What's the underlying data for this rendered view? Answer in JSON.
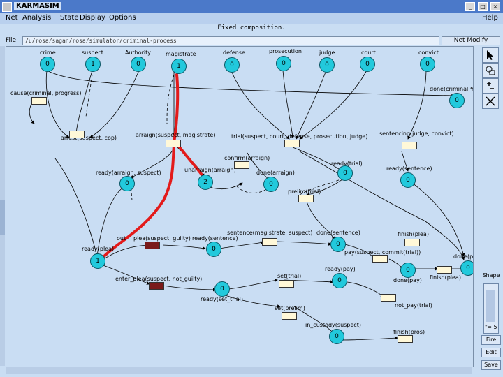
{
  "window": {
    "title": "KARMASIM",
    "buttons": [
      "_",
      "□",
      "×"
    ]
  },
  "menu": {
    "items": [
      "Net",
      "Analysis",
      "State",
      "Display",
      "Options"
    ],
    "help": "Help"
  },
  "net_name": "Fixed composition.",
  "file": {
    "label": "File",
    "path": "/u/rosa/sagan/rosa/simulator/criminal-process",
    "modify_label": "Net Modify"
  },
  "places": [
    {
      "name": "crime",
      "token": "0"
    },
    {
      "name": "suspect",
      "token": "1"
    },
    {
      "name": "Authority",
      "token": "0"
    },
    {
      "name": "magistrate",
      "token": "1"
    },
    {
      "name": "defense",
      "token": "0"
    },
    {
      "name": "prosecution",
      "token": "0"
    },
    {
      "name": "judge",
      "token": "0"
    },
    {
      "name": "court",
      "token": "0"
    },
    {
      "name": "convict",
      "token": "0"
    },
    {
      "name": "done(criminalProcess)",
      "token": "0"
    },
    {
      "name": "ready(arraign, suspect)",
      "token": "0"
    },
    {
      "name": "unarraign(arraign)",
      "token": "2"
    },
    {
      "name": "done(arraign)",
      "token": "0"
    },
    {
      "name": "ready(trial)",
      "token": "0"
    },
    {
      "name": "ready(sentence)",
      "token": "0"
    },
    {
      "name": "ready(plea)",
      "token": "1"
    },
    {
      "name": "ready(sentence)",
      "token": "0"
    },
    {
      "name": "done(sentence)",
      "token": "0"
    },
    {
      "name": "done(pay)",
      "token": "0"
    },
    {
      "name": "done(plea)",
      "token": "0"
    },
    {
      "name": "ready(pay)",
      "token": "0"
    },
    {
      "name": "ready(set_trial)",
      "token": "0"
    },
    {
      "name": "in_custody(suspect)",
      "token": "0"
    }
  ],
  "transitions": {
    "cause": "cause(criminal, progress)",
    "arrest": "arrest(suspect, cop)",
    "arraign": "arraign(suspect, magistrate)",
    "trial": "trial(suspect, court, defense, prosecution, judge)",
    "sentencing": "sentencing(judge, convict)",
    "confirm": "confirm(arraign)",
    "prelim": "prelim(trial)",
    "plea_guilty": "plea(suspect, guilty)",
    "enter_plea": "enter_plea(suspect, not_guilty)",
    "sentence": "sentence(magistrate, suspect)",
    "finish_plea": "finish(plea)",
    "pay": "pay(suspect, commit(trial))",
    "finish_plea2": "finish(plea)",
    "set_trial": "set(trial)",
    "not_pay": "not_pay(trial)",
    "set_prelim": "set(prelim)",
    "finish_pros": "finish(pros)",
    "out": "out"
  },
  "sidebar": {
    "shape_label": "Shape",
    "readout": "f= 5",
    "buttons": [
      "Fire",
      "Edit",
      "Save"
    ]
  },
  "colors": {
    "place": "#22c9dc",
    "highlight": "#e31b1b",
    "transition_fired": "#7a1a1a"
  }
}
